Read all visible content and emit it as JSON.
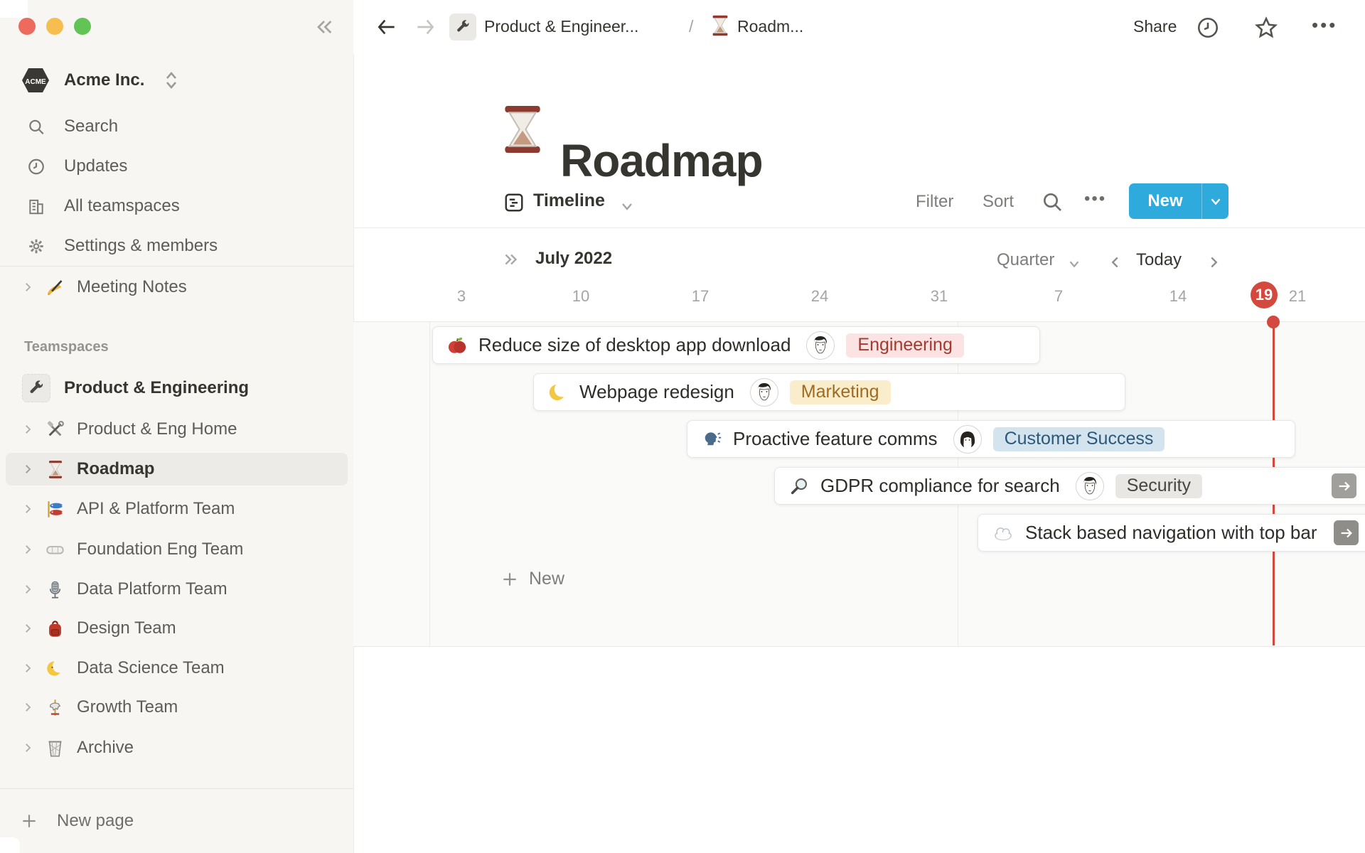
{
  "colors": {
    "accent_blue": "#2eaadc",
    "today_red": "#d3493d",
    "sidebar_bg": "#f7f6f3"
  },
  "sidebar": {
    "workspace": {
      "name": "Acme Inc.",
      "logo_text": "ACME"
    },
    "top_items": [
      {
        "label": "Search",
        "icon": "search-icon"
      },
      {
        "label": "Updates",
        "icon": "clock-icon"
      },
      {
        "label": "All teamspaces",
        "icon": "building-icon"
      },
      {
        "label": "Settings & members",
        "icon": "gear-icon"
      }
    ],
    "favorites": [
      {
        "label": "Meeting Notes",
        "icon": "writing-hand-icon"
      }
    ],
    "teamspaces_label": "Teamspaces",
    "teamspace_root": {
      "label": "Product & Engineering",
      "icon": "wrench-icon"
    },
    "teamspace_items": [
      {
        "label": "Product & Eng Home",
        "icon": "hammer-wrench-icon"
      },
      {
        "label": "Roadmap",
        "icon": "hourglass-icon"
      },
      {
        "label": "API & Platform Team",
        "icon": "carp-streamer-icon"
      },
      {
        "label": "Foundation Eng Team",
        "icon": "goggles-icon"
      },
      {
        "label": "Data Platform Team",
        "icon": "microphone-icon"
      },
      {
        "label": "Design Team",
        "icon": "backpack-icon"
      },
      {
        "label": "Data Science Team",
        "icon": "moon-face-icon"
      },
      {
        "label": "Growth Team",
        "icon": "carousel-icon"
      },
      {
        "label": "Archive",
        "icon": "wastebasket-icon"
      }
    ],
    "new_page": "New page"
  },
  "topbar": {
    "breadcrumb": [
      {
        "label": "Product & Engineer...",
        "icon": "wrench-icon"
      },
      {
        "label": "Roadm...",
        "icon": "hourglass-icon"
      }
    ],
    "separator": "/",
    "share": "Share",
    "dots": "•••"
  },
  "page": {
    "title": "Roadmap",
    "icon": "hourglass-icon"
  },
  "toolbar": {
    "view": "Timeline",
    "filter": "Filter",
    "sort": "Sort",
    "dots": "•••",
    "new": "New"
  },
  "timeline": {
    "month": "July 2022",
    "zoom": "Quarter",
    "today": "Today",
    "dates": [
      "3",
      "10",
      "17",
      "24",
      "31",
      "7",
      "14",
      "19",
      "21"
    ],
    "today_date": "19",
    "new": "New",
    "cards": [
      {
        "title": "Reduce size of desktop app download",
        "icon": "apple-icon",
        "avatar": "man-avatar",
        "tag": {
          "label": "Engineering",
          "bg": "#fae3e2",
          "fg": "#a13b30"
        }
      },
      {
        "title": "Webpage redesign",
        "icon": "crescent-moon-icon",
        "avatar": "man-avatar",
        "tag": {
          "label": "Marketing",
          "bg": "#faedcc",
          "fg": "#9d6c22"
        }
      },
      {
        "title": "Proactive feature comms",
        "icon": "speaking-head-icon",
        "avatar": "woman-avatar",
        "tag": {
          "label": "Customer Success",
          "bg": "#d4e4ef",
          "fg": "#2d5877"
        }
      },
      {
        "title": "GDPR compliance for search",
        "icon": "magnifier-icon",
        "avatar": "man-avatar",
        "tag": {
          "label": "Security",
          "bg": "#e8e7e4",
          "fg": "#474540"
        }
      },
      {
        "title": "Stack based navigation with top bar",
        "icon": "cloud-icon"
      }
    ]
  }
}
